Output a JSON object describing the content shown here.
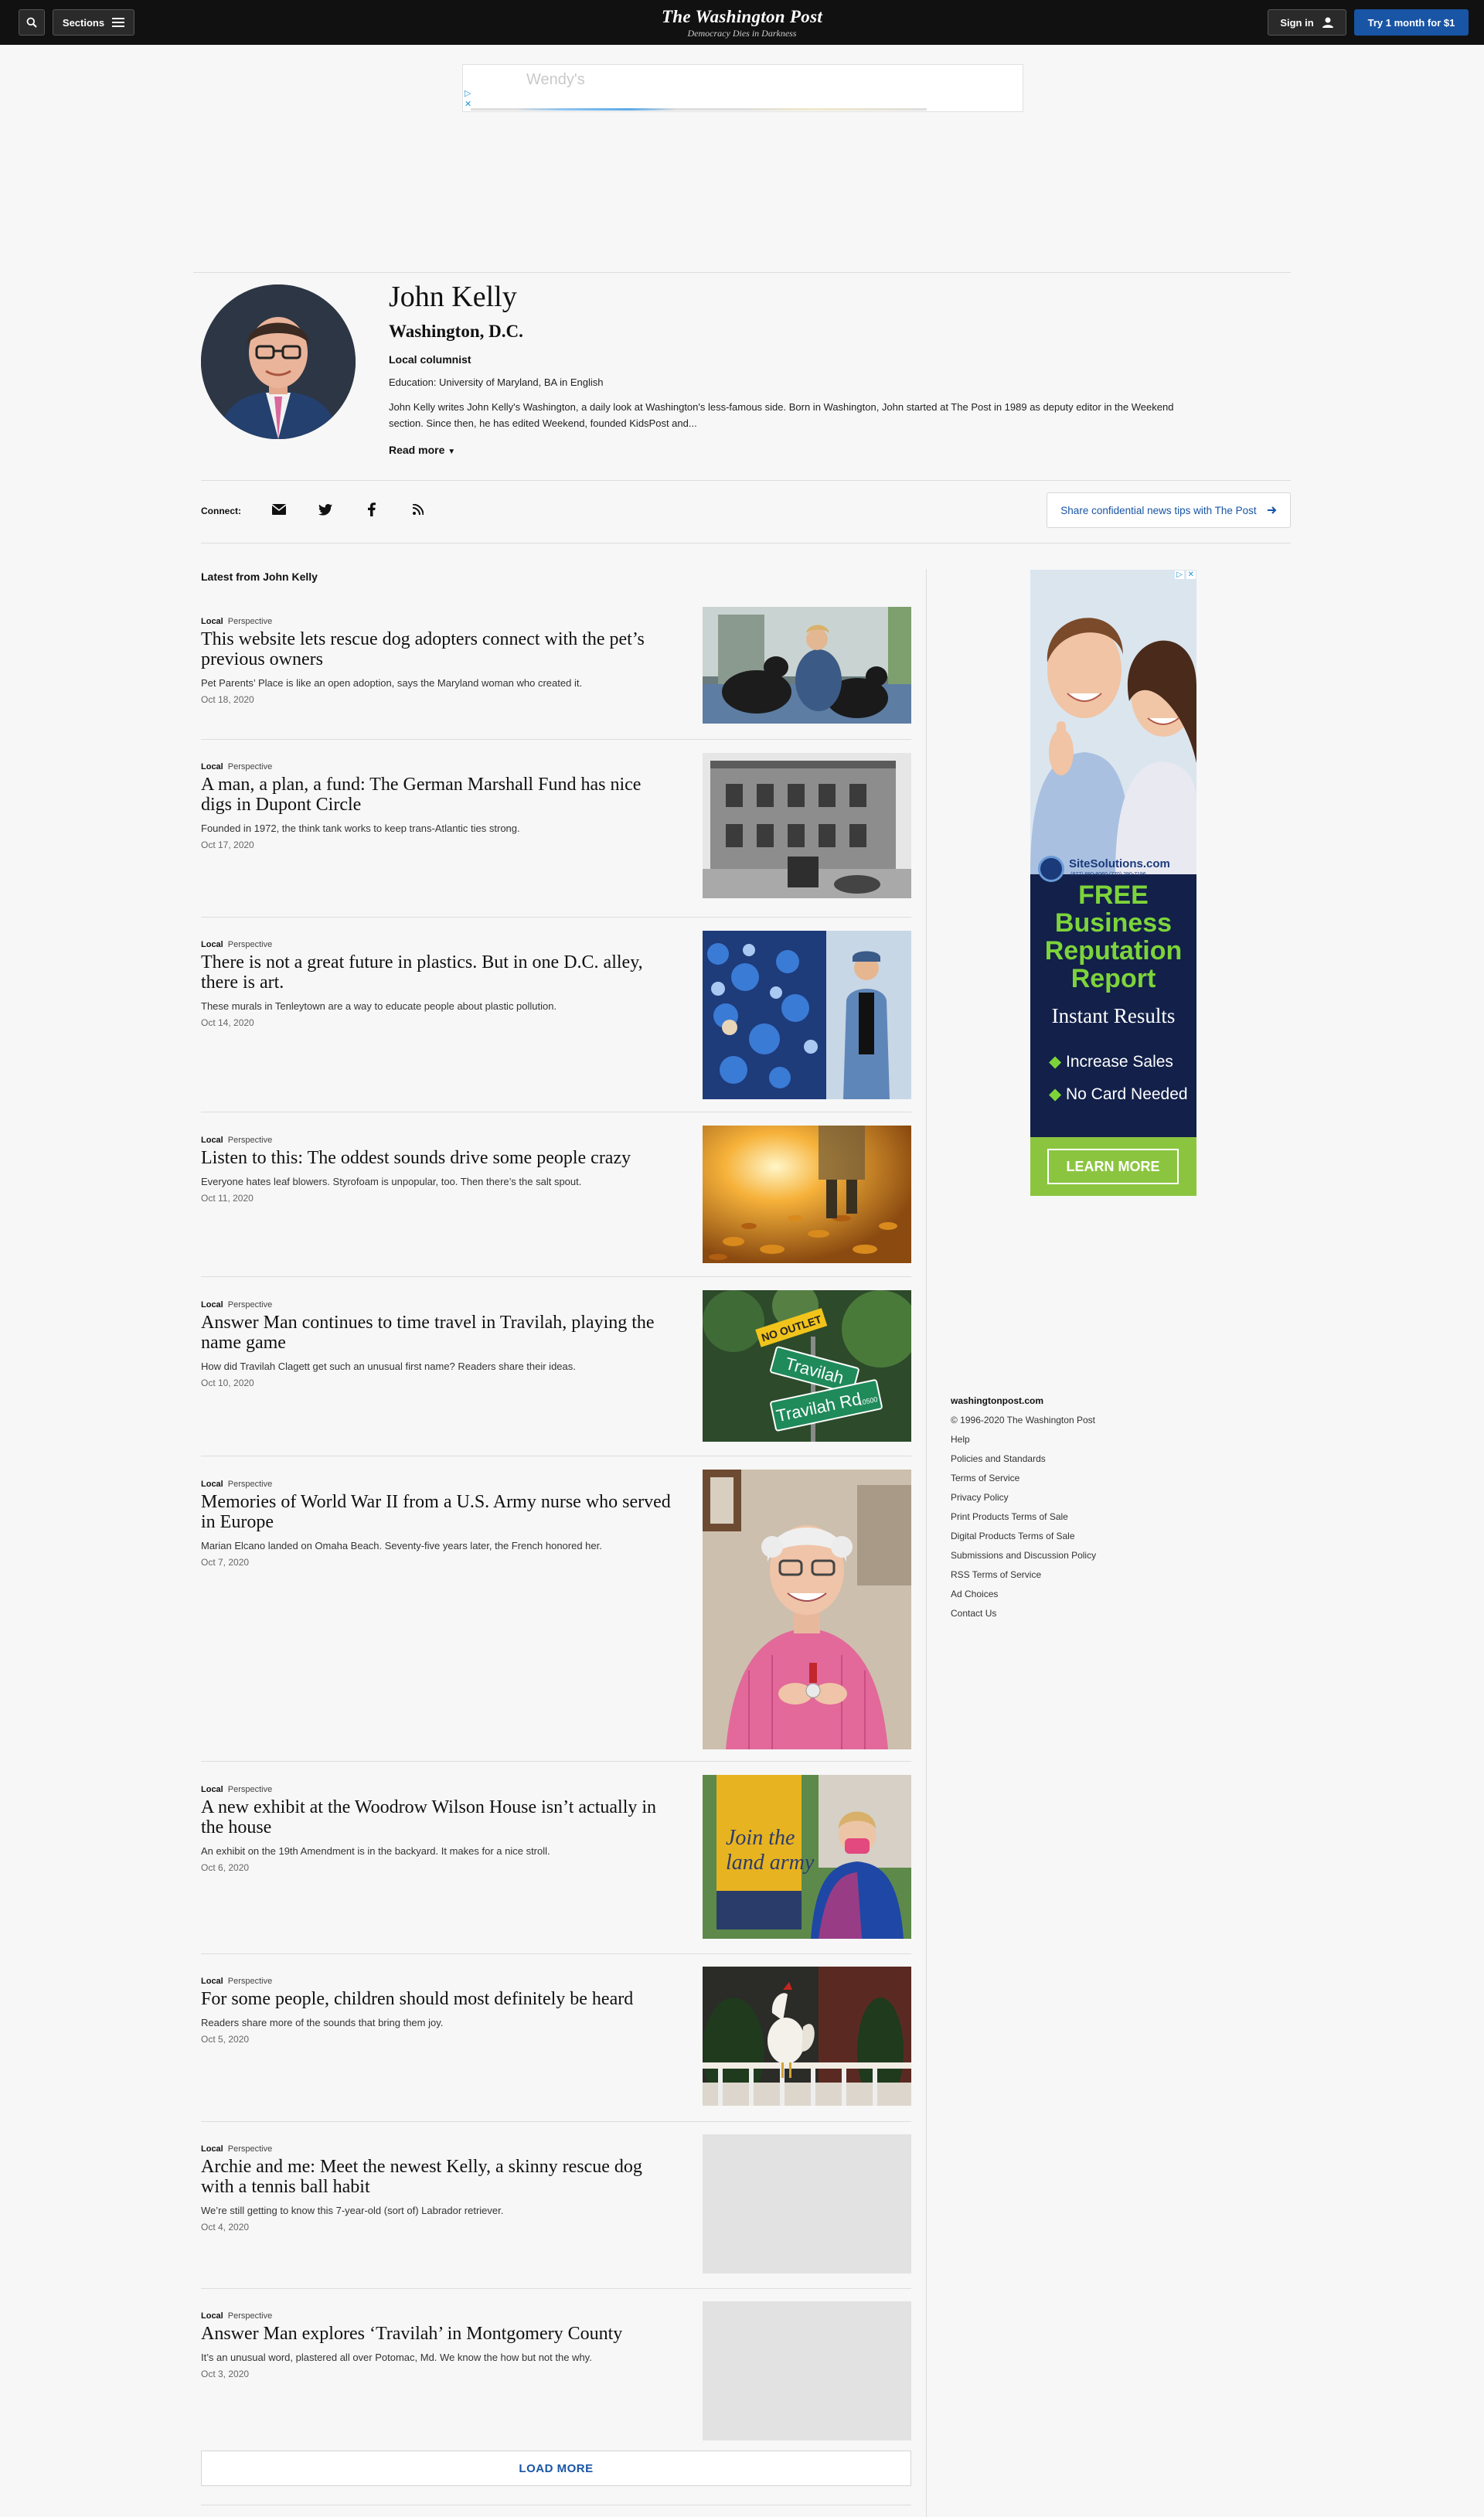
{
  "navbar": {
    "sections_label": "Sections",
    "brand": "The Washington Post",
    "tagline": "Democracy Dies in Darkness",
    "sign_in_label": "Sign in",
    "subscribe_label": "Try 1 month for $1"
  },
  "top_ad": {
    "text": "Wendy's"
  },
  "author": {
    "name": "John Kelly",
    "location": "Washington, D.C.",
    "role": "Local columnist",
    "education": "Education: University of Maryland, BA in English",
    "bio": "John Kelly writes John Kelly's Washington, a daily look at Washington's less-famous side. Born in Washington, John started at The Post in 1989 as deputy editor in the Weekend section. Since then, he has edited Weekend, founded KidsPost and...",
    "read_more": "Read more"
  },
  "connect": {
    "label": "Connect:",
    "icons": [
      "email-icon",
      "twitter-icon",
      "facebook-icon",
      "rss-icon"
    ],
    "tips_label": "Share confidential news tips with The Post"
  },
  "latest_heading": "Latest from John Kelly",
  "articles": [
    {
      "section": "Local",
      "label": "Perspective",
      "title": "This website lets rescue dog adopters connect with the pet’s previous owners",
      "blurb": "Pet Parents’ Place is like an open adoption, says the Maryland woman who created it.",
      "date": "Oct 18, 2020"
    },
    {
      "section": "Local",
      "label": "Perspective",
      "title": "A man, a plan, a fund: The German Marshall Fund has nice digs in Dupont Circle",
      "blurb": "Founded in 1972, the think tank works to keep trans-Atlantic ties strong.",
      "date": "Oct 17, 2020"
    },
    {
      "section": "Local",
      "label": "Perspective",
      "title": "There is not a great future in plastics. But in one D.C. alley, there is art.",
      "blurb": "These murals in Tenleytown are a way to educate people about plastic pollution.",
      "date": "Oct 14, 2020"
    },
    {
      "section": "Local",
      "label": "Perspective",
      "title": "Listen to this: The oddest sounds drive some people crazy",
      "blurb": "Everyone hates leaf blowers. Styrofoam is unpopular, too. Then there’s the salt spout.",
      "date": "Oct 11, 2020"
    },
    {
      "section": "Local",
      "label": "Perspective",
      "title": "Answer Man continues to time travel in Travilah, playing the name game",
      "blurb": "How did Travilah Clagett get such an unusual first name? Readers share their ideas.",
      "date": "Oct 10, 2020"
    },
    {
      "section": "Local",
      "label": "Perspective",
      "title": "Memories of World War II from a U.S. Army nurse who served in Europe",
      "blurb": "Marian Elcano landed on Omaha Beach. Seventy-five years later, the French honored her.",
      "date": "Oct 7, 2020"
    },
    {
      "section": "Local",
      "label": "Perspective",
      "title": "A new exhibit at the Woodrow Wilson House isn’t actually in the house",
      "blurb": "An exhibit on the 19th Amendment is in the backyard. It makes for a nice stroll.",
      "date": "Oct 6, 2020"
    },
    {
      "section": "Local",
      "label": "Perspective",
      "title": "For some people, children should most definitely be heard",
      "blurb": "Readers share more of the sounds that bring them joy.",
      "date": "Oct 5, 2020"
    },
    {
      "section": "Local",
      "label": "Perspective",
      "title": "Archie and me: Meet the newest Kelly, a skinny rescue dog with a tennis ball habit",
      "blurb": "We’re still getting to know this 7-year-old (sort of) Labrador retriever.",
      "date": "Oct 4, 2020"
    },
    {
      "section": "Local",
      "label": "Perspective",
      "title": "Answer Man explores ‘Travilah’ in Montgomery County",
      "blurb": "It’s an unusual word, plastered all over Potomac, Md. We know the how but not the why.",
      "date": "Oct 3, 2020"
    }
  ],
  "load_more": "LOAD MORE",
  "side_ad": {
    "brand": "SiteSolutions.com",
    "phone": "(877) 880-8060 (770) 290-7196",
    "line1": "FREE",
    "line2": "Business",
    "line3": "Reputation",
    "line4": "Report",
    "line5": "Instant Results",
    "bullet1": "Increase Sales",
    "bullet2": "No Card Needed",
    "cta": "LEARN MORE"
  },
  "thumb_signs": {
    "sign1": "NO OUTLET",
    "sign2": "Travilah",
    "sign3": "Travilah Rd",
    "sign3_num": "10500"
  },
  "thumb_banner": {
    "line1": "Join the",
    "line2": "land army"
  },
  "footer": {
    "items": [
      "washingtonpost.com",
      "© 1996-2020 The Washington Post",
      "Help",
      "Policies and Standards",
      "Terms of Service",
      "Privacy Policy",
      "Print Products Terms of Sale",
      "Digital Products Terms of Sale",
      "Submissions and Discussion Policy",
      "RSS Terms of Service",
      "Ad Choices",
      "Contact Us"
    ]
  }
}
